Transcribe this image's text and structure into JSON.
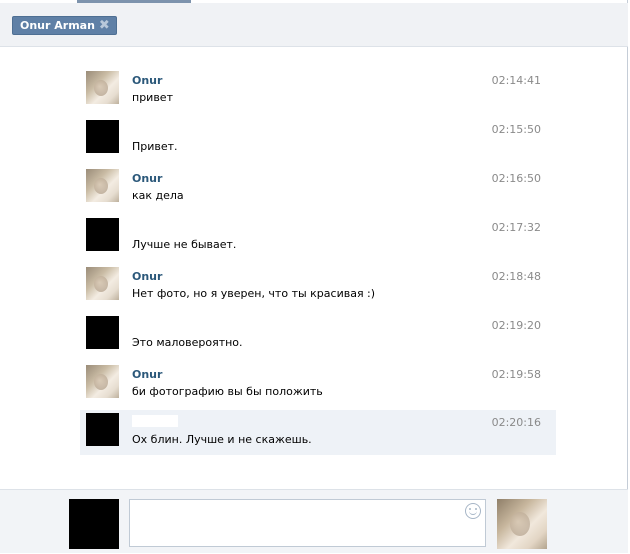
{
  "tab": {
    "label": "Onur Arman",
    "close_glyph": "✖"
  },
  "messages": [
    {
      "sender": "Onur",
      "avatar": "photo",
      "time": "02:14:41",
      "text": "привет"
    },
    {
      "sender": "",
      "avatar": "black",
      "time": "02:15:50",
      "text": "Привет."
    },
    {
      "sender": "Onur",
      "avatar": "photo",
      "time": "02:16:50",
      "text": "как дела"
    },
    {
      "sender": "",
      "avatar": "black",
      "time": "02:17:32",
      "text": "Лучше не бывает."
    },
    {
      "sender": "Onur",
      "avatar": "photo",
      "time": "02:18:48",
      "text": "Нет фото, но я уверен, что ты красивая :)"
    },
    {
      "sender": "",
      "avatar": "black",
      "time": "02:19:20",
      "text": "Это маловероятно."
    },
    {
      "sender": "Onur",
      "avatar": "photo",
      "time": "02:19:58",
      "text": "би фотографию вы бы положить"
    },
    {
      "sender": "",
      "avatar": "black",
      "time": "02:20:16",
      "text": "Ох блин. Лучше и не скажешь.",
      "highlight": true
    }
  ],
  "composer": {
    "value": "",
    "icon": "smile-icon"
  },
  "colors": {
    "tab_bg": "#5f80a6",
    "sender": "#2b587a",
    "highlight_bg": "#eef2f7"
  }
}
